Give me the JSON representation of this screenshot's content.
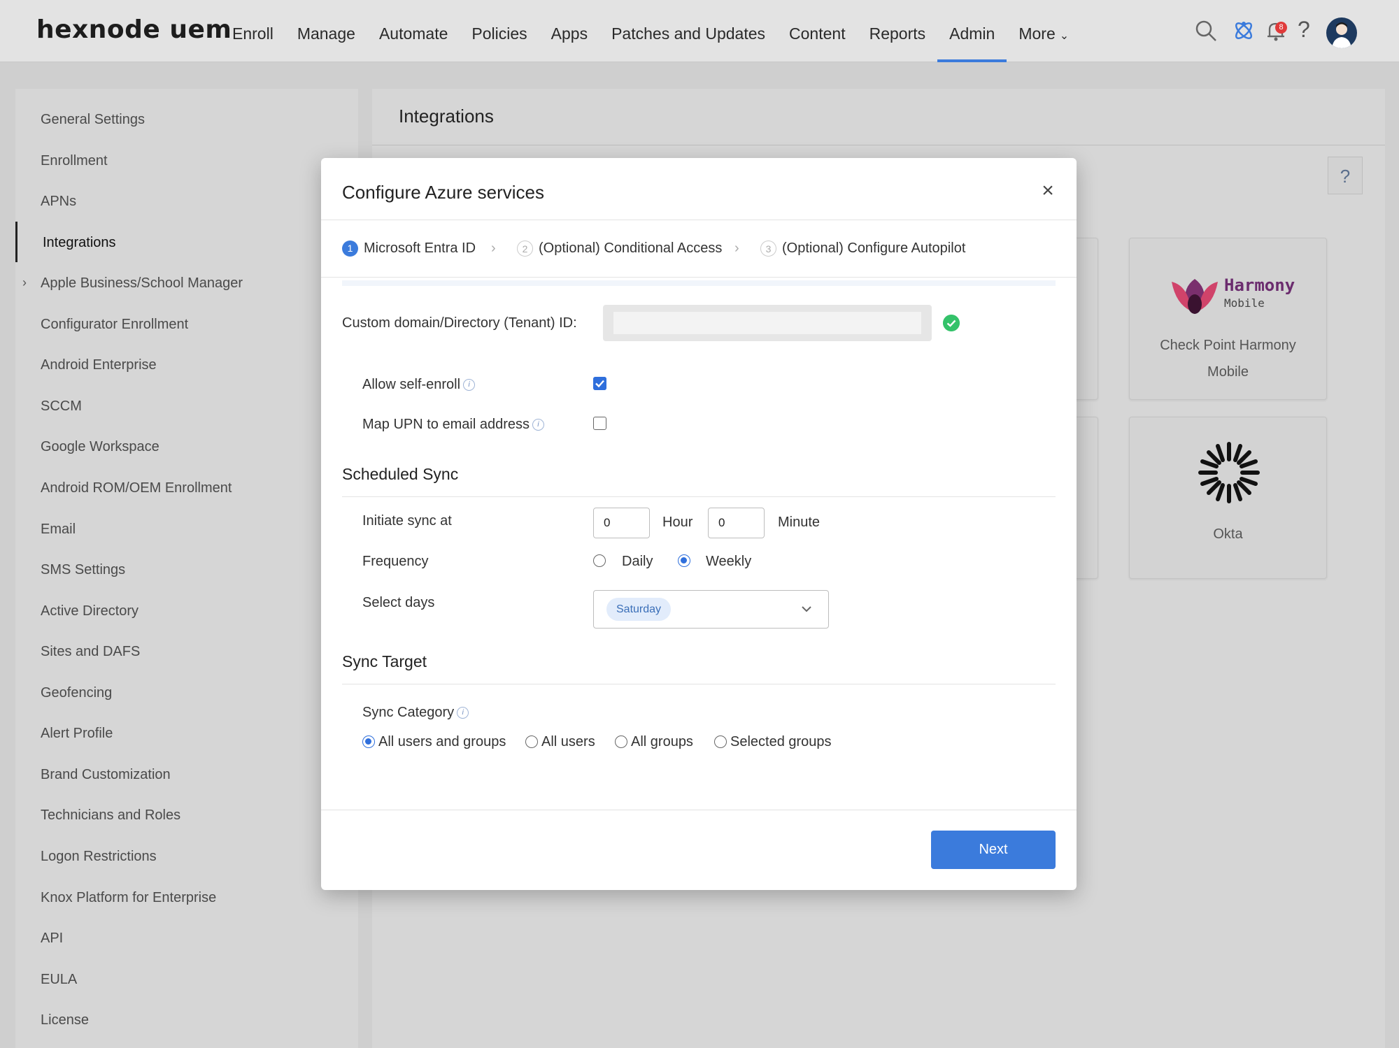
{
  "app": {
    "logo_text": "hexnode uem"
  },
  "nav": {
    "items": [
      "Enroll",
      "Manage",
      "Automate",
      "Policies",
      "Apps",
      "Patches and Updates",
      "Content",
      "Reports",
      "Admin"
    ],
    "active": "Admin",
    "more_label": "More",
    "notification_count": "8"
  },
  "sidebar": {
    "items": [
      "General Settings",
      "Enrollment",
      "APNs",
      "Integrations",
      "Apple Business/School Manager",
      "Configurator Enrollment",
      "Android Enterprise",
      "SCCM",
      "Google Workspace",
      "Android ROM/OEM Enrollment",
      "Email",
      "SMS Settings",
      "Active Directory",
      "Sites and DAFS",
      "Geofencing",
      "Alert Profile",
      "Brand Customization",
      "Technicians and Roles",
      "Logon Restrictions",
      "Knox Platform for Enterprise",
      "API",
      "EULA",
      "License"
    ],
    "active": "Integrations"
  },
  "main": {
    "title": "Integrations",
    "help": "?",
    "cards": [
      {
        "label_line1": "Check Point Harmony",
        "label_line2": "Mobile",
        "logo_text": "Harmony",
        "logo_sub": "Mobile"
      },
      {
        "label_line1": "Okta",
        "label_line2": ""
      }
    ]
  },
  "modal": {
    "title": "Configure Azure services",
    "steps": [
      {
        "num": "1",
        "label": "Microsoft Entra ID",
        "active": true
      },
      {
        "num": "2",
        "label": "(Optional) Conditional Access",
        "active": false
      },
      {
        "num": "3",
        "label": "(Optional) Configure Autopilot",
        "active": false
      }
    ],
    "tenant_label": "Custom domain/Directory (Tenant) ID:",
    "tenant_value": "",
    "allow_self_enroll": {
      "label": "Allow self-enroll",
      "checked": true
    },
    "map_upn": {
      "label": "Map UPN to email address",
      "checked": false
    },
    "scheduled_sync": {
      "title": "Scheduled Sync",
      "initiate_label": "Initiate sync at",
      "hour_value": "0",
      "hour_label": "Hour",
      "minute_value": "0",
      "minute_label": "Minute",
      "frequency_label": "Frequency",
      "frequency_options": [
        "Daily",
        "Weekly"
      ],
      "frequency_selected": "Weekly",
      "select_days_label": "Select days",
      "selected_day": "Saturday"
    },
    "sync_target": {
      "title": "Sync Target",
      "category_label": "Sync Category",
      "options": [
        "All users and groups",
        "All users",
        "All groups",
        "Selected groups"
      ],
      "selected": "All users and groups"
    },
    "next_label": "Next"
  },
  "colors": {
    "accent": "#3b7bdc",
    "success": "#34c26a",
    "badge": "#e03a3a",
    "harmony_purple": "#6b2c6e"
  }
}
